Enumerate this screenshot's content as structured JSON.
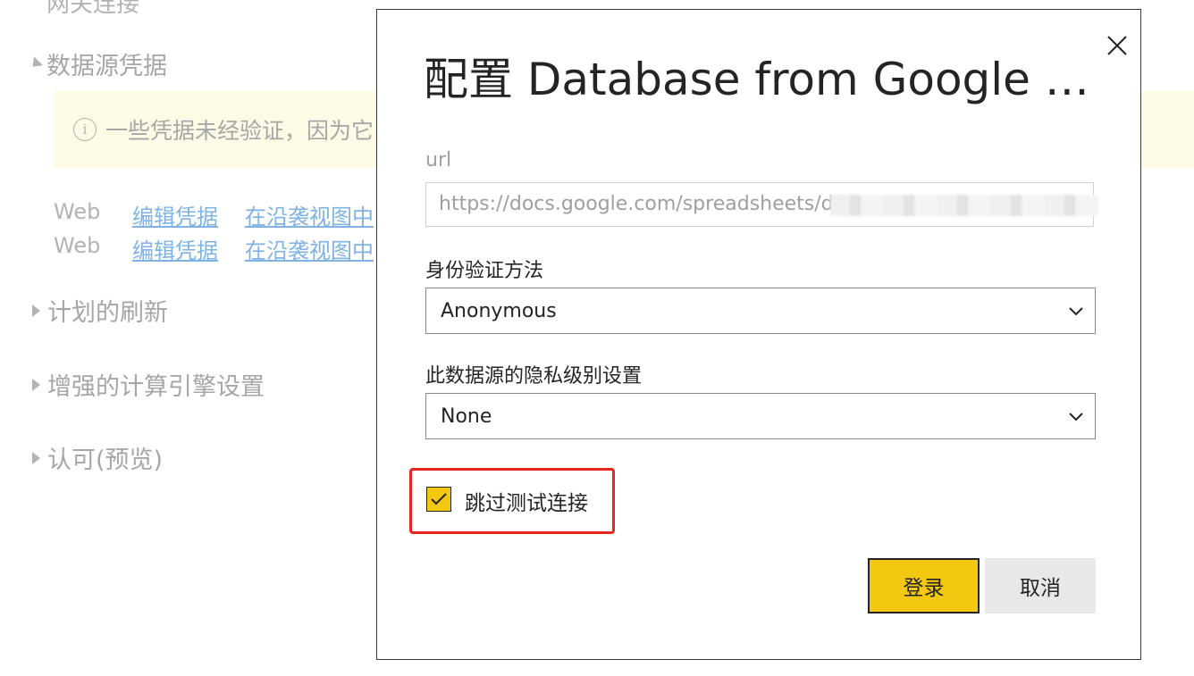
{
  "background": {
    "top_cut_text": "网关连接",
    "credentials_section": "数据源凭据",
    "warning_text": "一些凭据未经验证，因为它",
    "credential_rows": [
      {
        "type": "Web",
        "edit_link": "编辑凭据",
        "lineage_link": "在沿袭视图中"
      },
      {
        "type": "Web",
        "edit_link": "编辑凭据",
        "lineage_link": "在沿袭视图中"
      }
    ],
    "sections": [
      "计划的刷新",
      "增强的计算引擎设置",
      "认可(预览)"
    ]
  },
  "dialog": {
    "title": "配置 Database from Google S...",
    "url_label": "url",
    "url_value": "https://docs.google.com/spreadsheets/d/",
    "auth_label": "身份验证方法",
    "auth_value": "Anonymous",
    "privacy_label": "此数据源的隐私级别设置",
    "privacy_value": "None",
    "skip_test_label": "跳过测试连接",
    "skip_test_checked": true,
    "sign_in_button": "登录",
    "cancel_button": "取消"
  },
  "colors": {
    "accent_yellow": "#f2c811",
    "highlight_red": "#e5261f",
    "link_blue": "#7fb3e6",
    "banner_bg": "#fdfbe6"
  },
  "icons": {
    "close": "close-icon",
    "dropdown": "chevron-down-icon",
    "check": "checkmark-icon",
    "info": "info-icon"
  }
}
